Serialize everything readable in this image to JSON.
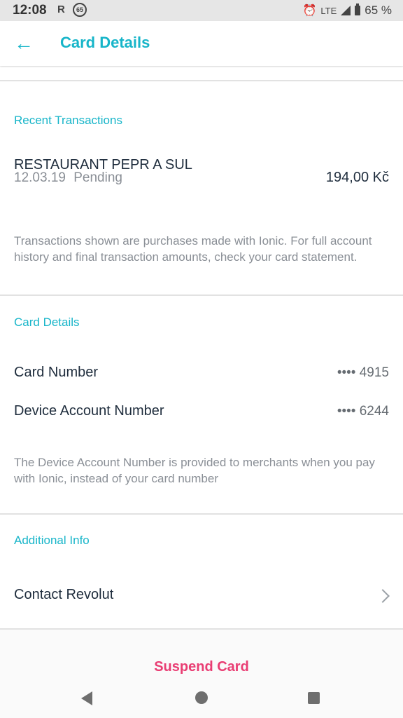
{
  "status_bar": {
    "time": "12:08",
    "icon_r": "R",
    "icon_65": "65",
    "network": "LTE",
    "battery": "65 %"
  },
  "app_bar": {
    "title": "Card Details",
    "back_icon": "arrow-left-icon",
    "accent_color": "#17b5c9"
  },
  "recent_transactions": {
    "heading": "Recent Transactions",
    "items": [
      {
        "merchant": "RESTAURANT PEPR A SUL",
        "date": "12.03.19",
        "status": "Pending",
        "amount": "194,00 Kč"
      }
    ],
    "note": "Transactions shown are purchases made with Ionic. For full account history and final transaction amounts, check your card statement."
  },
  "card_details": {
    "heading": "Card Details",
    "rows": [
      {
        "label": "Card Number",
        "value": "•••• 4915"
      },
      {
        "label": "Device Account Number",
        "value": "•••• 6244"
      }
    ],
    "note": "The Device Account Number is provided to merchants when you pay with Ionic, instead of your card number"
  },
  "additional_info": {
    "heading": "Additional Info",
    "contact_label": "Contact Revolut"
  },
  "actions": {
    "suspend_label": "Suspend Card",
    "suspend_color": "#e93d73"
  }
}
